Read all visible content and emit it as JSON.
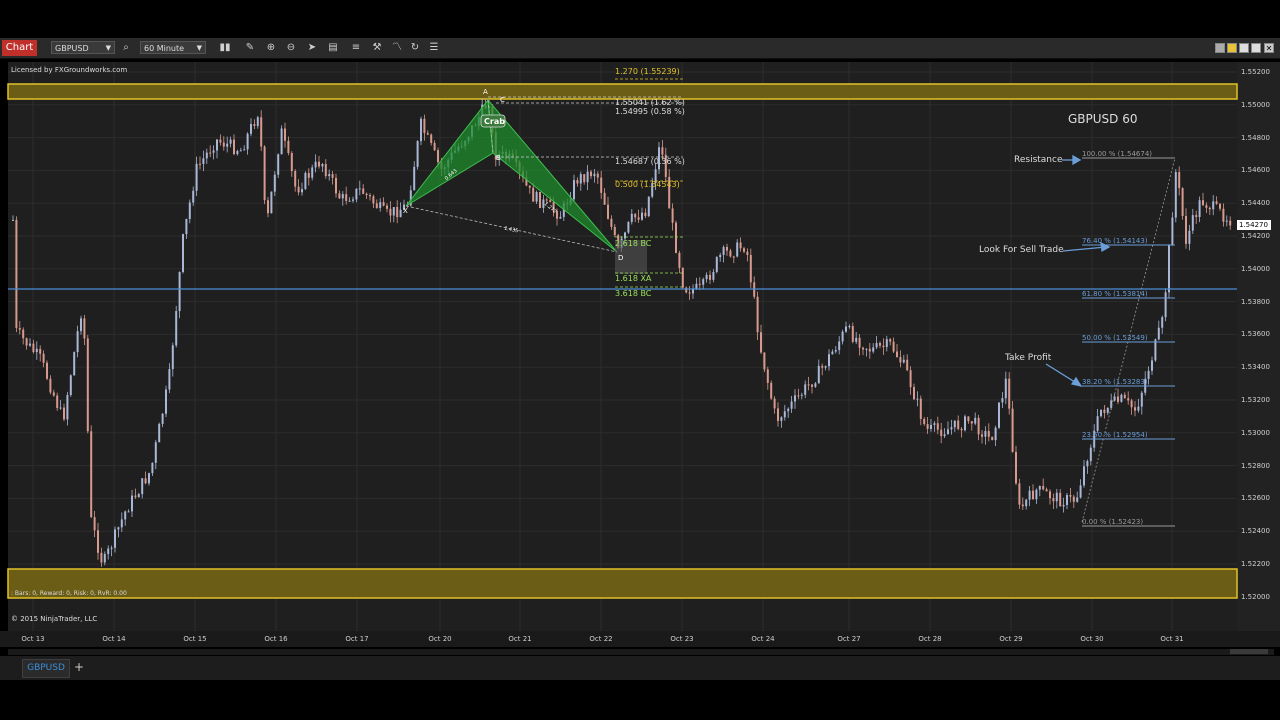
{
  "toolbar": {
    "chart_tab": "Chart",
    "symbol": "GBPUSD",
    "interval": "60 Minute",
    "icons": [
      "search-icon",
      "bar-type-icon",
      "pencil-icon",
      "zoom-in-icon",
      "zoom-out-icon",
      "pointer-icon",
      "data-box-icon",
      "drawing-tools-icon",
      "strategies-icon",
      "indicators-icon",
      "refresh-icon",
      "properties-icon"
    ]
  },
  "chart": {
    "license": "Licensed by FXGroundworks.com",
    "title": "GBPUSD 60",
    "copyright": "© 2015 NinjaTrader, LLC",
    "stats": ": Bars: 0, Reward: 0, Risk: 0, RvR: 0.00",
    "current_price": "1.54270",
    "price_ticks": [
      "1.55200",
      "1.55000",
      "1.54800",
      "1.54600",
      "1.54400",
      "1.54200",
      "1.54000",
      "1.53800",
      "1.53600",
      "1.53400",
      "1.53200",
      "1.53000",
      "1.52800",
      "1.52600",
      "1.52400",
      "1.52200",
      "1.52000"
    ],
    "date_ticks": [
      "Oct 13",
      "Oct 14",
      "Oct 15",
      "Oct 16",
      "Oct 17",
      "Oct 20",
      "Oct 21",
      "Oct 22",
      "Oct 23",
      "Oct 24",
      "Oct 27",
      "Oct 28",
      "Oct 29",
      "Oct 30",
      "Oct 31"
    ],
    "annotations": {
      "resistance": "Resistance",
      "sell": "Look For Sell Trade",
      "profit": "Take Profit"
    },
    "pattern": {
      "name": "Crab",
      "points": [
        "X",
        "A",
        "B",
        "C",
        "D"
      ],
      "ratios": [
        "0.643",
        "1.435",
        "0.618",
        "1.272"
      ],
      "levels": [
        "1.270 (1.55239)",
        "1.55041 (1.62 %)",
        "1.54995 (0.58 %)",
        "1.54687 (0.36 %)",
        "0.500 (1.54543)",
        "2.618 BC",
        "1.618 XA",
        "3.618 BC"
      ]
    },
    "fibonacci": [
      "100.00 % (1.54674)",
      "76.40 % (1.54143)",
      "61.80 % (1.53814)",
      "50.00 % (1.53549)",
      "38.20 % (1.53283)",
      "23.60 % (1.52954)",
      "0.00 % (1.52423)"
    ]
  },
  "tabs": {
    "symbol_tab": "GBPUSD",
    "add_tab": "+"
  },
  "colors": {
    "zone": "#e2c229",
    "bull": "#a9b8d6",
    "bear": "#d99a8e",
    "pattern": "#1f8c2c",
    "resistance_line": "#4a8fd6",
    "fib": "#6a9ed8"
  }
}
